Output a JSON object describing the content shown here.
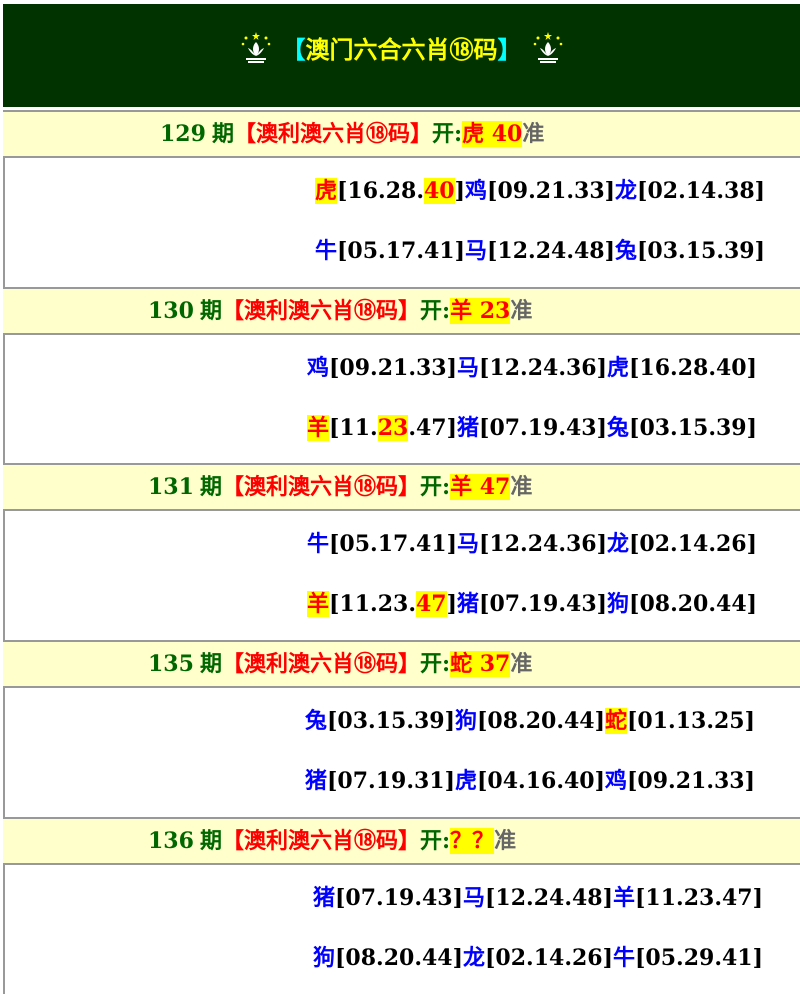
{
  "header": {
    "bracket_left": "【",
    "title": "澳门六合六肖⑱码",
    "bracket_right": "】",
    "emblem_icon": "macau-lotus-emblem"
  },
  "periods": [
    {
      "number": "129",
      "label": "期",
      "bracket_text": "【澳利澳六肖⑱码】",
      "open_label": "开:",
      "result": "虎 40",
      "accurate": "准",
      "lines": [
        [
          {
            "z": "虎",
            "pre": "[16.28.",
            "hit": "40",
            "post": "]",
            "zhl": true
          },
          {
            "z": "鸡",
            "pre": "[09.21.33]"
          },
          {
            "z": "龙",
            "pre": "[02.14.38]"
          }
        ],
        [
          {
            "z": "牛",
            "pre": "[05.17.41]"
          },
          {
            "z": "马",
            "pre": "[12.24.48]"
          },
          {
            "z": "兔",
            "pre": "[03.15.39]"
          }
        ]
      ]
    },
    {
      "number": "130",
      "label": "期",
      "bracket_text": "【澳利澳六肖⑱码】",
      "open_label": "开:",
      "result": "羊 23",
      "accurate": "准",
      "lines": [
        [
          {
            "z": "鸡",
            "pre": "[09.21.33]"
          },
          {
            "z": "马",
            "pre": "[12.24.36]"
          },
          {
            "z": "虎",
            "pre": "[16.28.40]"
          }
        ],
        [
          {
            "z": "羊",
            "pre": "[11.",
            "hit": "23",
            "post": ".47]",
            "zhl": true
          },
          {
            "z": "猪",
            "pre": "[07.19.43]"
          },
          {
            "z": "兔",
            "pre": "[03.15.39]"
          }
        ]
      ]
    },
    {
      "number": "131",
      "label": "期",
      "bracket_text": "【澳利澳六肖⑱码】",
      "open_label": "开:",
      "result": "羊 47",
      "accurate": "准",
      "lines": [
        [
          {
            "z": "牛",
            "pre": "[05.17.41]"
          },
          {
            "z": "马",
            "pre": "[12.24.36]"
          },
          {
            "z": "龙",
            "pre": "[02.14.26]"
          }
        ],
        [
          {
            "z": "羊",
            "pre": "[11.23.",
            "hit": "47",
            "post": "]",
            "zhl": true
          },
          {
            "z": "猪",
            "pre": "[07.19.43]"
          },
          {
            "z": "狗",
            "pre": "[08.20.44]"
          }
        ]
      ]
    },
    {
      "number": "135",
      "label": "期",
      "bracket_text": "【澳利澳六肖⑱码】",
      "open_label": "开:",
      "result": "蛇 37",
      "accurate": "准",
      "lines": [
        [
          {
            "z": "兔",
            "pre": "[03.15.39]"
          },
          {
            "z": "狗",
            "pre": "[08.20.44]"
          },
          {
            "z": "蛇",
            "pre": "[01.13.25]",
            "zhl": true
          }
        ],
        [
          {
            "z": "猪",
            "pre": "[07.19.31]"
          },
          {
            "z": "虎",
            "pre": "[04.16.40]"
          },
          {
            "z": "鸡",
            "pre": "[09.21.33]"
          }
        ]
      ]
    },
    {
      "number": "136",
      "label": "期",
      "bracket_text": "【澳利澳六肖⑱码】",
      "open_label": "开:",
      "result": "？？",
      "accurate": "准",
      "lines": [
        [
          {
            "z": "猪",
            "pre": "[07.19.43]"
          },
          {
            "z": "马",
            "pre": "[12.24.48]"
          },
          {
            "z": "羊",
            "pre": "[11.23.47]"
          }
        ],
        [
          {
            "z": "狗",
            "pre": "[08.20.44]"
          },
          {
            "z": "龙",
            "pre": "[02.14.26]"
          },
          {
            "z": "牛",
            "pre": "[05.29.41]"
          }
        ]
      ]
    }
  ]
}
